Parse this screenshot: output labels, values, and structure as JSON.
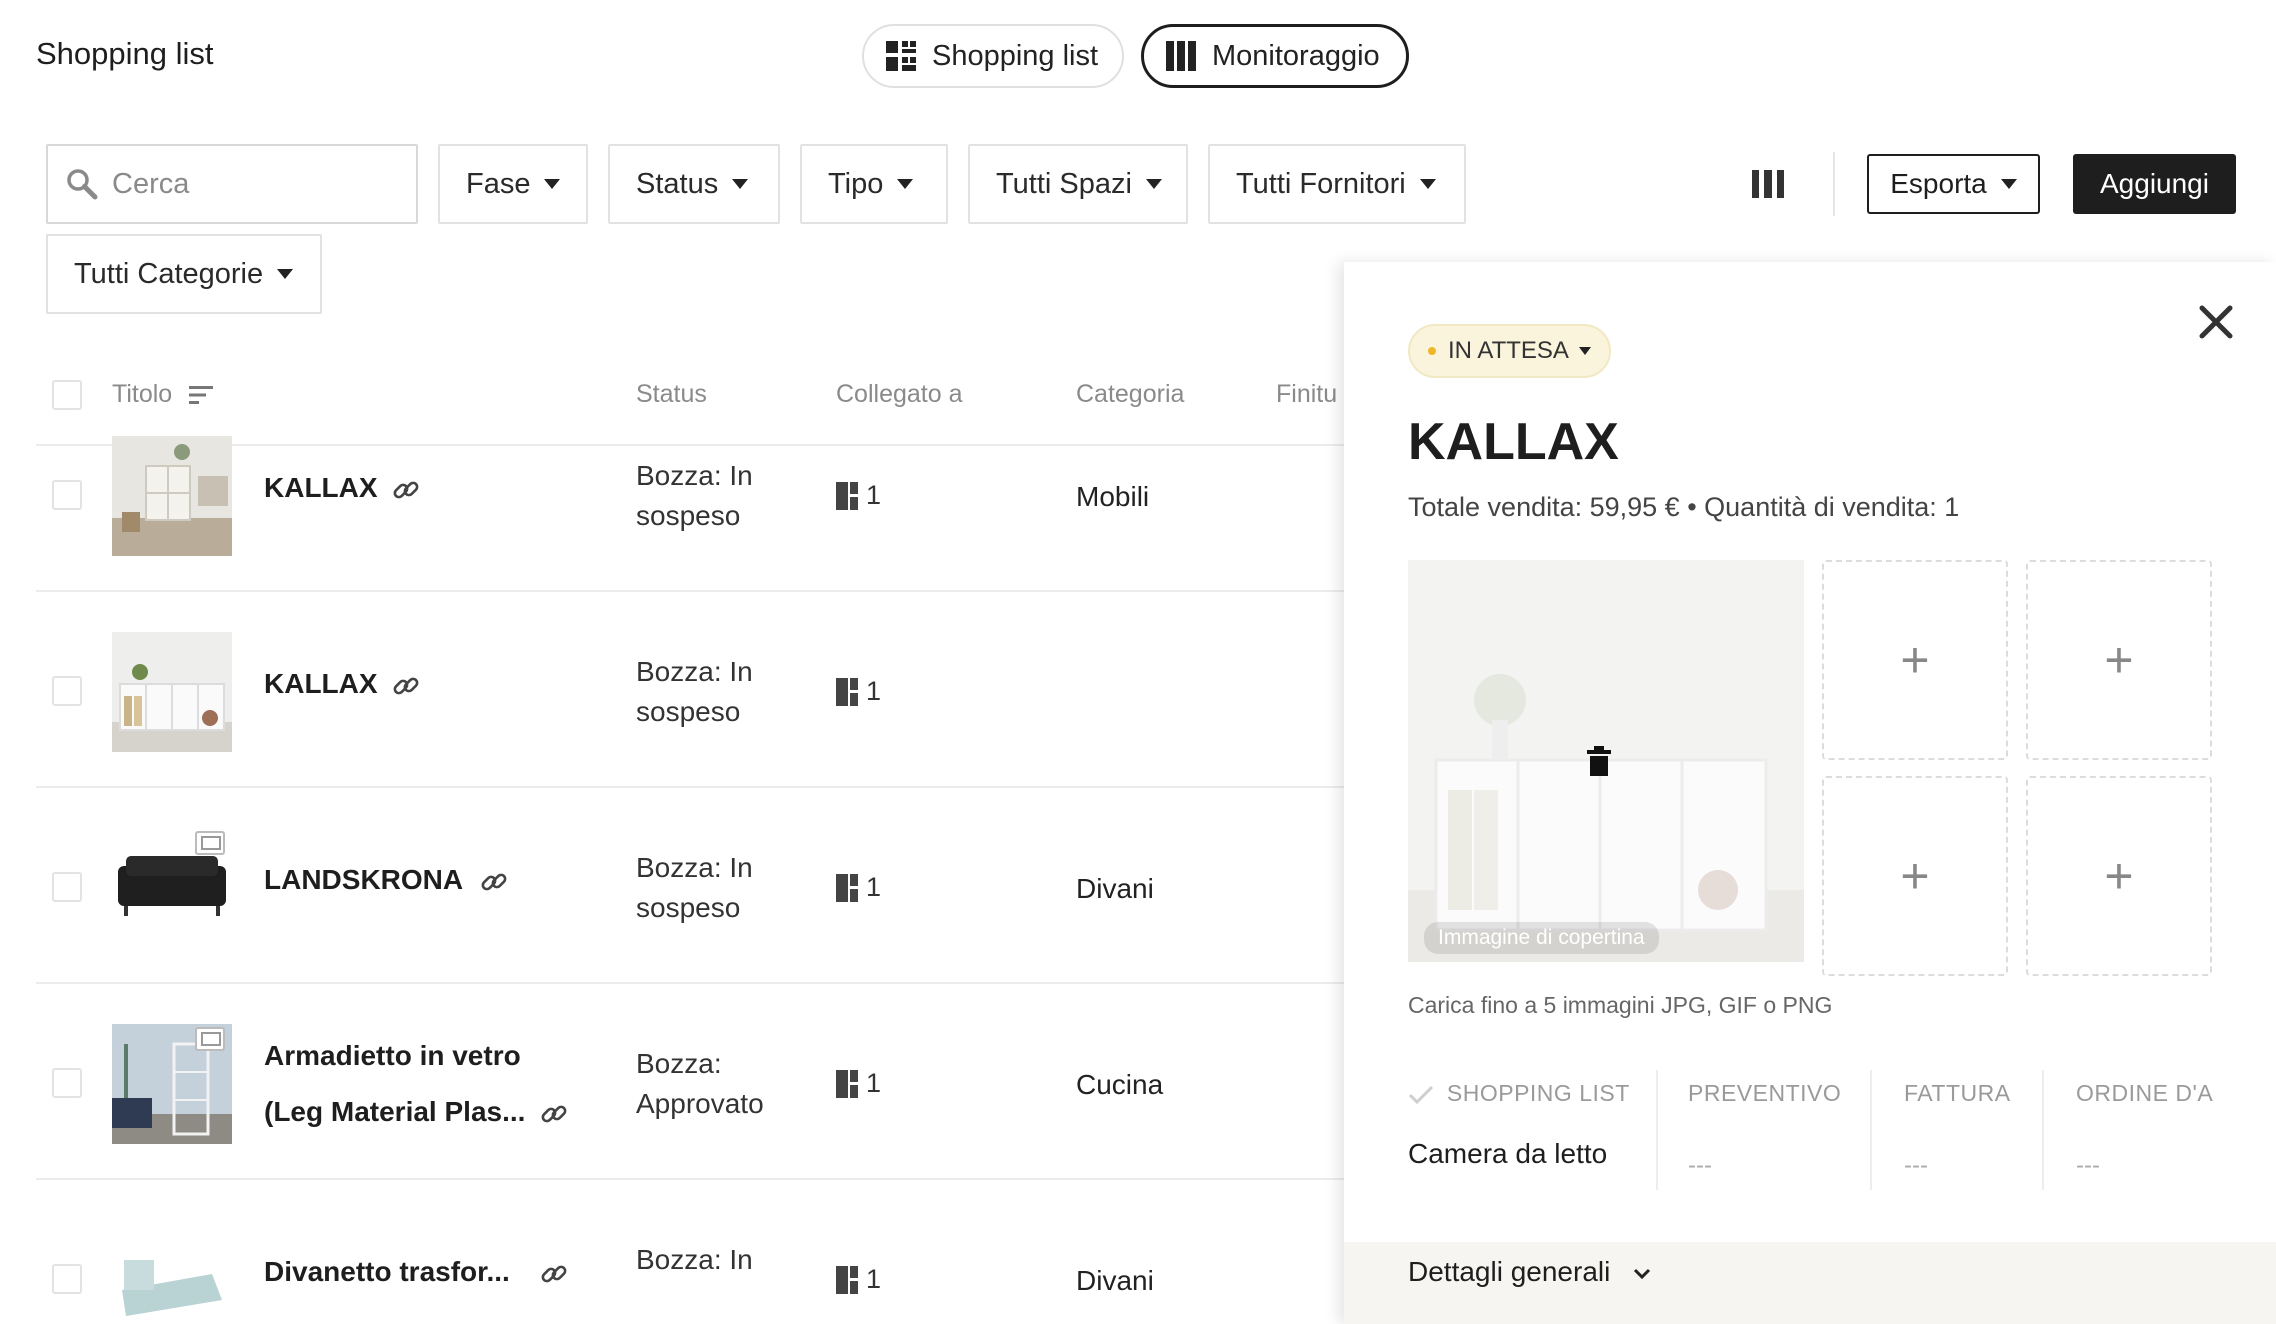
{
  "header": {
    "title": "Shopping list",
    "view_shopping": "Shopping list",
    "view_monitor": "Monitoraggio"
  },
  "filters": {
    "search_placeholder": "Cerca",
    "fase": "Fase",
    "status": "Status",
    "tipo": "Tipo",
    "spazi": "Tutti Spazi",
    "fornitori": "Tutti Fornitori",
    "categorie": "Tutti Categorie"
  },
  "actions": {
    "export": "Esporta",
    "add": "Aggiungi"
  },
  "table": {
    "headers": {
      "title": "Titolo",
      "status": "Status",
      "linked": "Collegato a",
      "category": "Categoria",
      "finish": "Finitu"
    },
    "rows": [
      {
        "title": "KALLAX",
        "status": "Bozza: In sospeso",
        "linked": "1",
        "category": "Mobili"
      },
      {
        "title": "KALLAX",
        "status": "Bozza: In sospeso",
        "linked": "1",
        "category": ""
      },
      {
        "title": "LANDSKRONA",
        "status": "Bozza: In sospeso",
        "linked": "1",
        "category": "Divani"
      },
      {
        "title_line1": "Armadietto in vetro",
        "title_line2": "(Leg Material Plas...",
        "status": "Bozza: Approvato",
        "linked": "1",
        "category": "Cucina"
      },
      {
        "title": "Divanetto trasfor...",
        "status": "Bozza: In",
        "linked": "1",
        "category": "Divani"
      }
    ]
  },
  "panel": {
    "badge": "IN ATTESA",
    "title": "KALLAX",
    "subtitle": "Totale vendita: 59,95 € • Quantità di vendita: 1",
    "cover_label": "Immagine di copertina",
    "add_symbol": "+",
    "upload_hint": "Carica fino a 5 immagini JPG, GIF o PNG",
    "stages": [
      {
        "label": "SHOPPING LIST",
        "value": "Camera da letto"
      },
      {
        "label": "PREVENTIVO",
        "value": "---"
      },
      {
        "label": "FATTURA",
        "value": "---"
      },
      {
        "label": "ORDINE D'A",
        "value": "---"
      }
    ],
    "details": "Dettagli generali"
  },
  "colors": {
    "primary": "#1e1e1e",
    "badge_bg": "#fbf4dc",
    "badge_dot": "#f0b62a",
    "muted": "#8a8a8a"
  }
}
